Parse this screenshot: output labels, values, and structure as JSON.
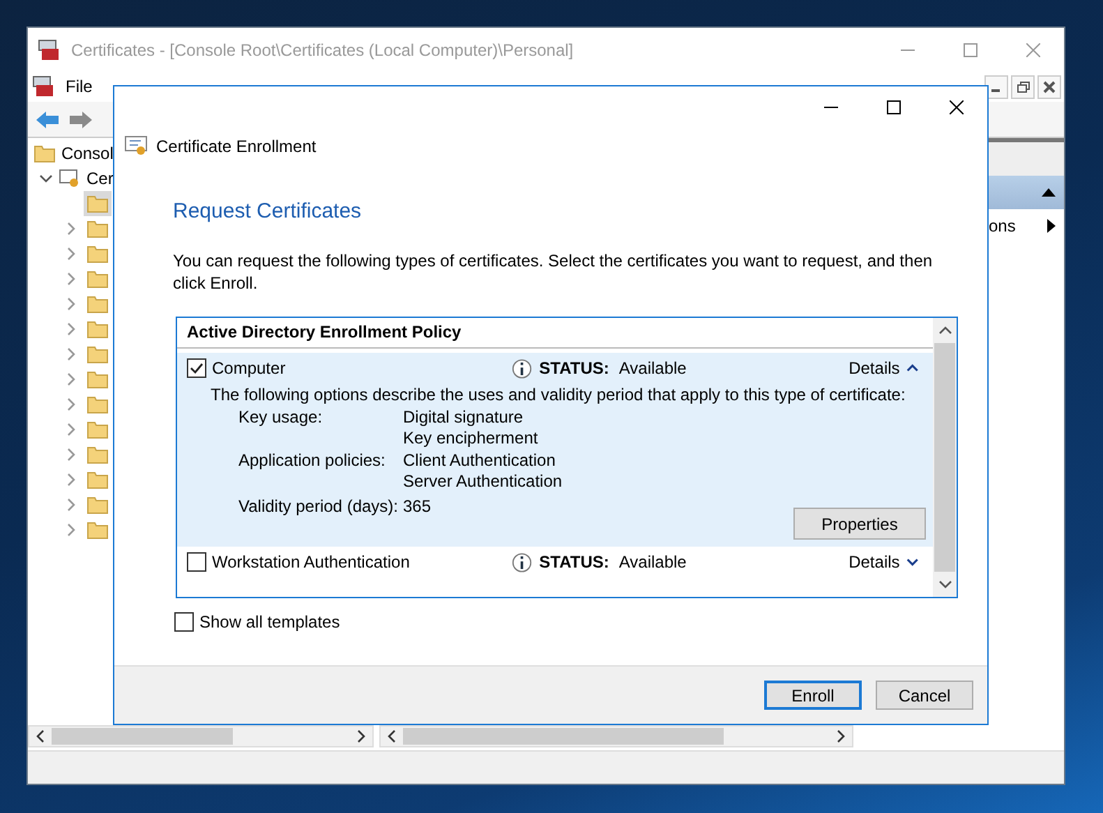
{
  "background_window": {
    "title": "Certificates - [Console Root\\Certificates (Local Computer)\\Personal]",
    "menu": [
      "File"
    ],
    "tree": [
      {
        "label": "Consol",
        "children": [
          {
            "label": "Cer",
            "expanded": true,
            "children": [
              {
                "selected": true,
                "has_children": false
              },
              {
                "selected": false,
                "has_children": true
              },
              {
                "selected": false,
                "has_children": true
              },
              {
                "selected": false,
                "has_children": true
              },
              {
                "selected": false,
                "has_children": true
              },
              {
                "selected": false,
                "has_children": true
              },
              {
                "selected": false,
                "has_children": true
              },
              {
                "selected": false,
                "has_children": true
              },
              {
                "selected": false,
                "has_children": true
              },
              {
                "selected": false,
                "has_children": true
              },
              {
                "selected": false,
                "has_children": true
              },
              {
                "selected": false,
                "has_children": true
              },
              {
                "selected": false,
                "has_children": true
              },
              {
                "selected": false,
                "has_children": true
              }
            ]
          }
        ]
      }
    ],
    "actions_pane": {
      "items": [
        {
          "label": "ons"
        }
      ]
    }
  },
  "dialog": {
    "title": "Certificate Enrollment",
    "heading": "Request Certificates",
    "description": "You can request the following types of certificates. Select the certificates you want to request, and then click Enroll.",
    "policy": {
      "name": "Active Directory Enrollment Policy",
      "templates": [
        {
          "name": "Computer",
          "checked": true,
          "status_label": "STATUS:",
          "status": "Available",
          "details_label": "Details",
          "expanded": true,
          "intro": "The following options describe the uses and validity period that apply to this type of certificate:",
          "properties": [
            {
              "label": "Key usage:",
              "values": [
                "Digital signature",
                "Key encipherment"
              ]
            },
            {
              "label": "Application policies:",
              "values": [
                "Client Authentication",
                "Server Authentication"
              ]
            },
            {
              "label": "Validity period (days):",
              "values": [
                "365"
              ]
            }
          ],
          "button": "Properties"
        },
        {
          "name": "Workstation Authentication",
          "checked": false,
          "status_label": "STATUS:",
          "status": "Available",
          "details_label": "Details",
          "expanded": false
        }
      ]
    },
    "show_all": {
      "label": "Show all templates",
      "checked": false
    },
    "buttons": [
      {
        "label": "Enroll",
        "default": true
      },
      {
        "label": "Cancel",
        "default": false
      }
    ]
  }
}
